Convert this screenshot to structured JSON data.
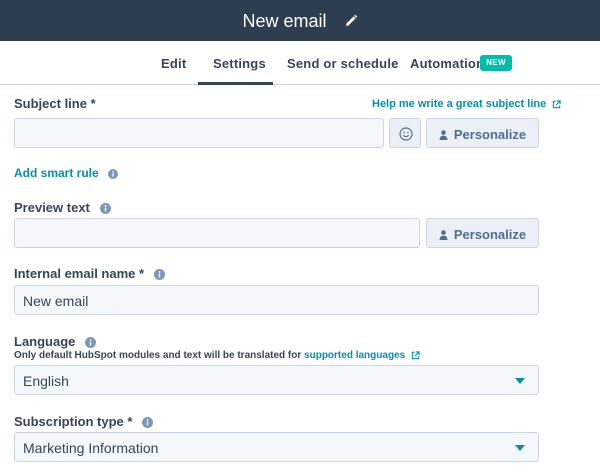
{
  "header": {
    "title": "New email"
  },
  "tabs": [
    {
      "label": "Edit"
    },
    {
      "label": "Settings"
    },
    {
      "label": "Send or schedule"
    },
    {
      "label": "Automation",
      "badge": "NEW"
    }
  ],
  "subject": {
    "label": "Subject line *",
    "value": "",
    "help_link": "Help me write a great subject line",
    "personalize_label": "Personalize"
  },
  "smart_rule": {
    "label": "Add smart rule"
  },
  "preview": {
    "label": "Preview text",
    "value": "",
    "personalize_label": "Personalize"
  },
  "internal_name": {
    "label": "Internal email name *",
    "value": "New email"
  },
  "language": {
    "label": "Language",
    "help_prefix": "Only default HubSpot modules and text will be translated for",
    "help_link": "supported languages",
    "value": "English"
  },
  "subscription": {
    "label": "Subscription type *",
    "value": "Marketing Information"
  },
  "colors": {
    "header_bg": "#2d3e50",
    "accent_link": "#0091ae",
    "badge_bg": "#00bda5",
    "text": "#33475b"
  }
}
